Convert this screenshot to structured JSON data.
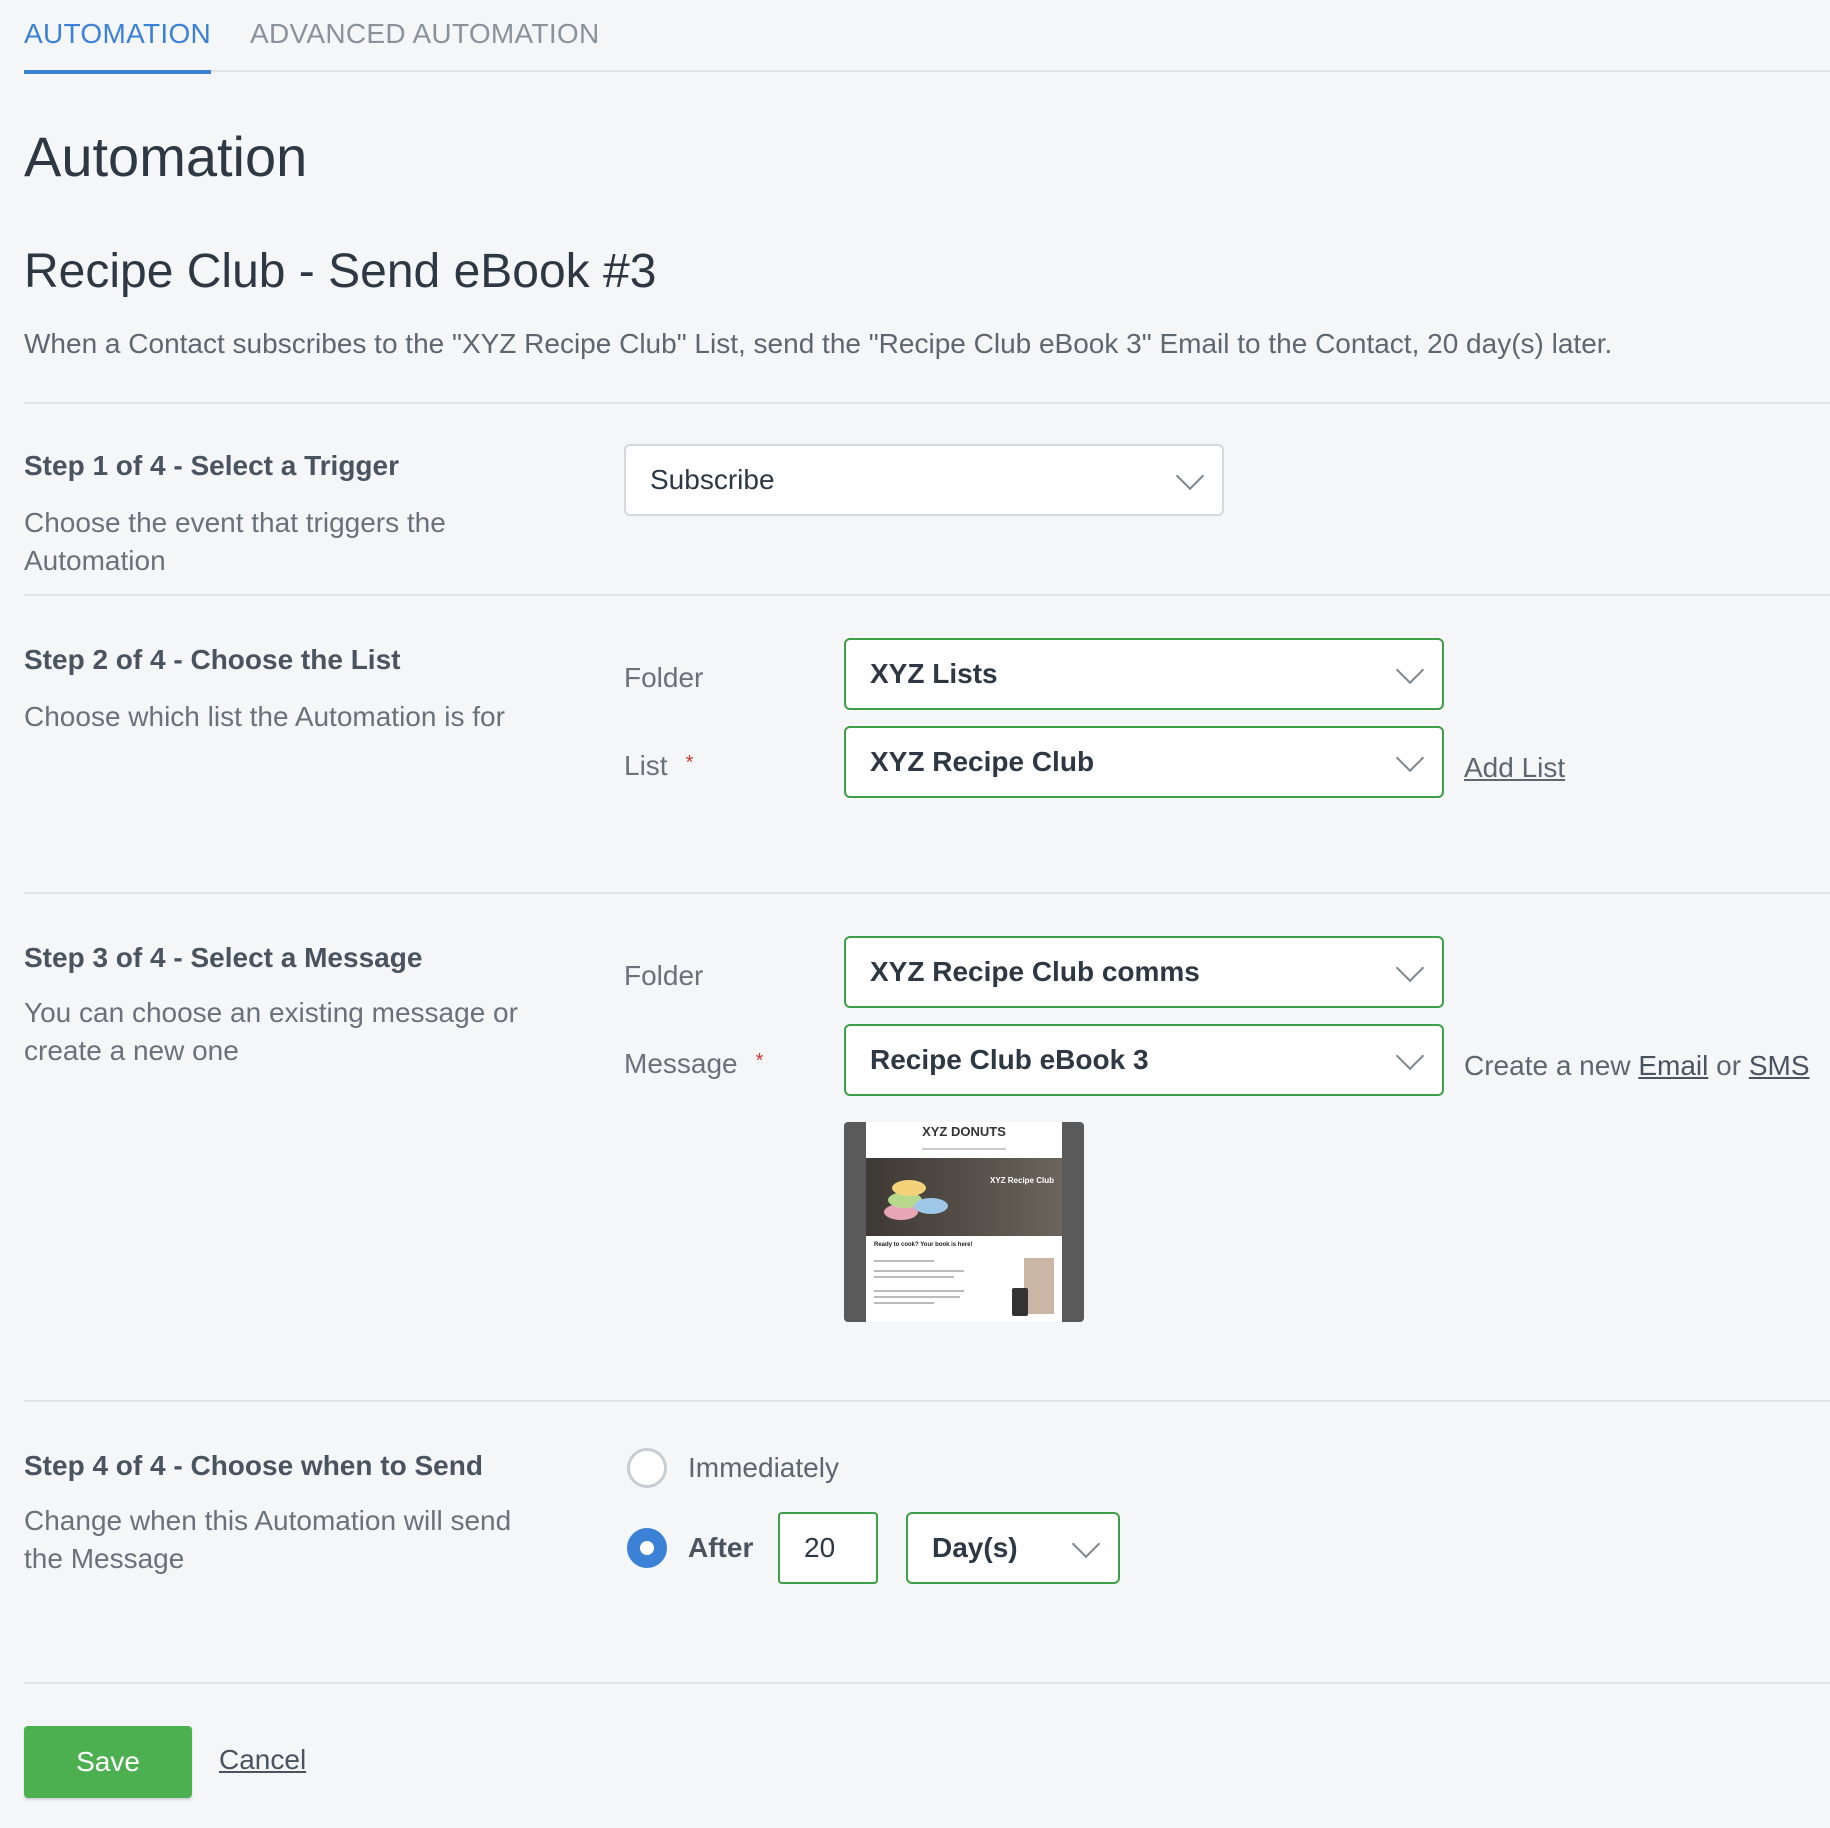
{
  "tabs": [
    {
      "label": "AUTOMATION",
      "active": true
    },
    {
      "label": "ADVANCED AUTOMATION",
      "active": false
    }
  ],
  "page_title": "Automation",
  "automation": {
    "name": "Recipe Club - Send eBook #3",
    "description": "When a Contact subscribes to the \"XYZ Recipe Club\" List, send the \"Recipe Club eBook 3\" Email to the Contact, 20 day(s) later."
  },
  "steps": {
    "step1": {
      "title": "Step 1 of 4 - Select a Trigger",
      "description": "Choose the event that triggers the Automation",
      "trigger_value": "Subscribe"
    },
    "step2": {
      "title": "Step 2 of 4 - Choose the List",
      "description": "Choose which list the Automation is for",
      "folder_label": "Folder",
      "folder_value": "XYZ Lists",
      "list_label": "List",
      "list_value": "XYZ Recipe Club",
      "add_list_link": "Add List",
      "required_marker": "*"
    },
    "step3": {
      "title": "Step 3 of 4 - Select a Message",
      "description": "You can choose an existing message or create a new one",
      "folder_label": "Folder",
      "folder_value": "XYZ Recipe Club comms",
      "message_label": "Message",
      "message_value": "Recipe Club eBook 3",
      "create_prefix": "Create a new",
      "email_link": "Email",
      "or_text": "or",
      "sms_link": "SMS",
      "required_marker": "*",
      "preview": {
        "logo_text": "XYZ DONUTS",
        "hero_text": "XYZ Recipe Club",
        "heading_text": "Ready to cook? Your book is here!"
      }
    },
    "step4": {
      "title": "Step 4 of 4 - Choose when to Send",
      "description": "Change when this Automation will send the Message",
      "option_immediately": "Immediately",
      "option_after": "After",
      "selected": "after",
      "after_value": "20",
      "unit_value": "Day(s)"
    }
  },
  "actions": {
    "save_label": "Save",
    "cancel_label": "Cancel"
  },
  "colors": {
    "accent": "#3b82d6",
    "valid_border": "#3f9e4a",
    "save_button": "#4caf50",
    "required": "#d03a2e"
  }
}
